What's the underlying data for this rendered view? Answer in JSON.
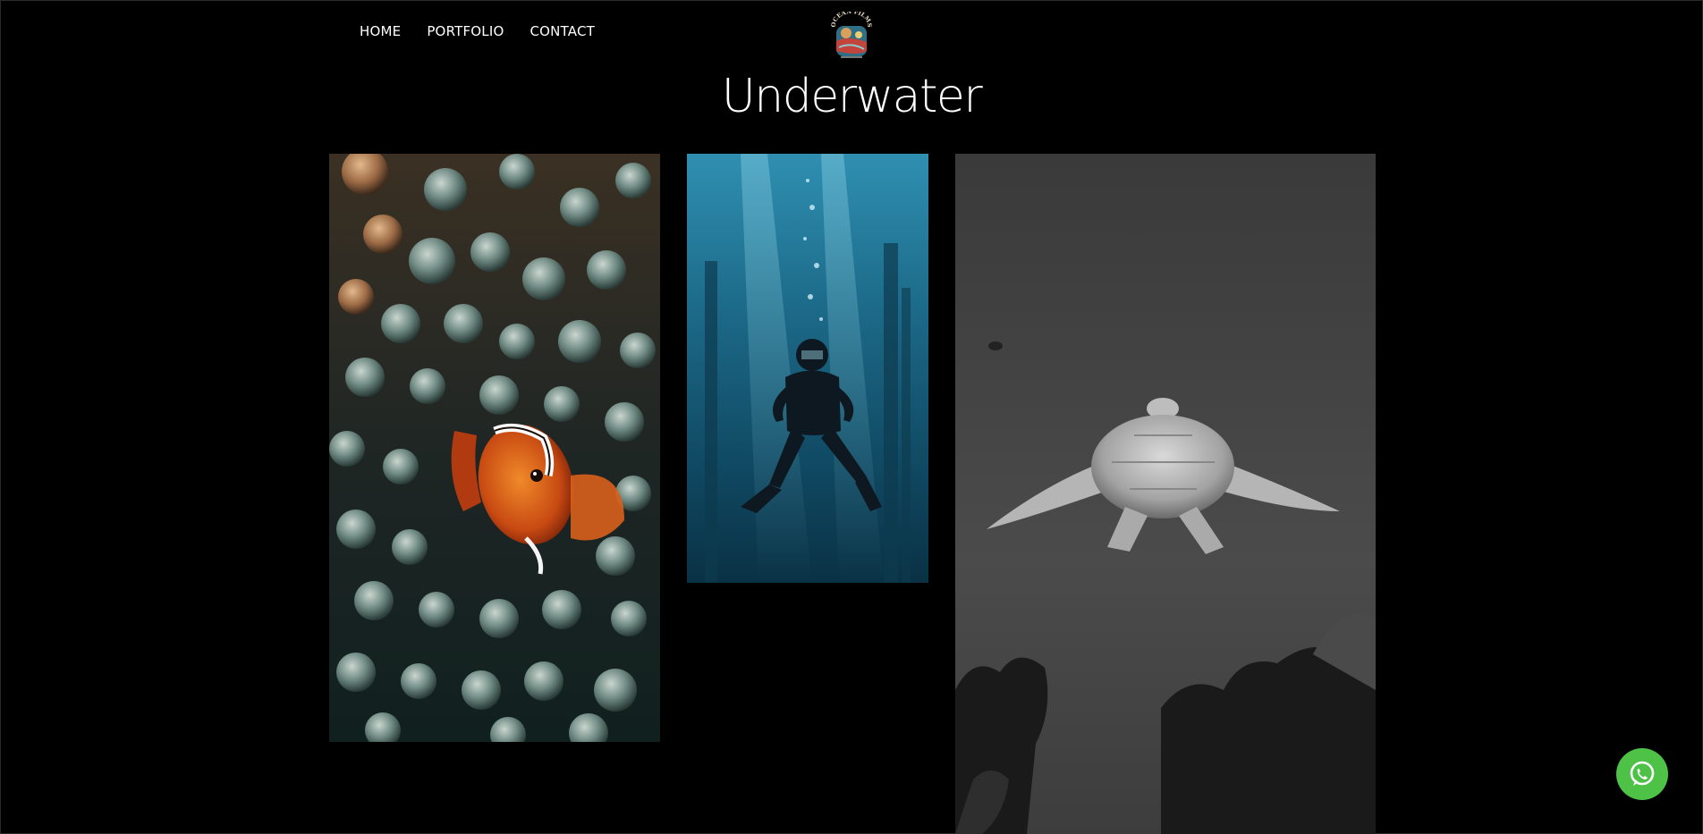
{
  "nav": {
    "items": [
      {
        "label": "HOME"
      },
      {
        "label": "PORTFOLIO"
      },
      {
        "label": "CONTACT"
      }
    ]
  },
  "logo": {
    "text_top": "OCEAN FILMS",
    "icon": "ocean-films-logo"
  },
  "page": {
    "title": "Underwater"
  },
  "gallery": {
    "images": [
      {
        "subject": "clownfish-in-anemone"
      },
      {
        "subject": "scuba-diver"
      },
      {
        "subject": "sea-turtle-black-and-white"
      }
    ]
  },
  "whatsapp": {
    "icon": "whatsapp-icon",
    "color": "#4dc247"
  },
  "colors": {
    "background": "#000000",
    "text": "#ffffff"
  }
}
